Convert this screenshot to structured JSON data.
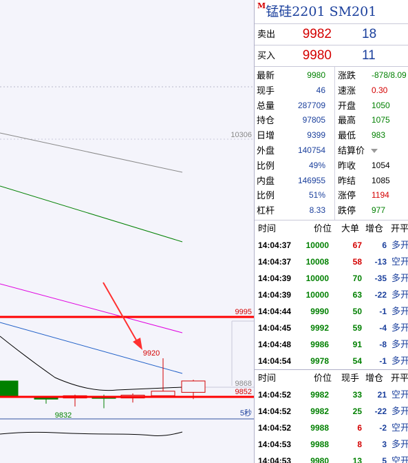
{
  "chart": {
    "level_labels": {
      "high": "10306",
      "resist": "9995",
      "current": "9868",
      "support": "9852"
    },
    "annot_high": "9920",
    "annot_low": "9832",
    "period": "5秒",
    "colors": {
      "red_line": "#ff0000",
      "bg": "#f4f4fb"
    },
    "bars": [
      {
        "type": "down",
        "open": 9880,
        "close": 9852,
        "high": 9880,
        "low": 9852
      },
      {
        "type": "down",
        "open": 9852,
        "close": 9848,
        "high": 9853,
        "low": 9840
      },
      {
        "type": "up",
        "open": 9850,
        "close": 9854,
        "high": 9856,
        "low": 9835
      },
      {
        "type": "down",
        "open": 9853,
        "close": 9850,
        "high": 9856,
        "low": 9832
      },
      {
        "type": "up",
        "open": 9850,
        "close": 9855,
        "high": 9858,
        "low": 9842
      },
      {
        "type": "up",
        "open": 9854,
        "close": 9862,
        "high": 9920,
        "low": 9852
      },
      {
        "type": "up",
        "open": 9860,
        "close": 9880,
        "high": 9882,
        "low": 9848
      }
    ]
  },
  "panel": {
    "title_mark": "M",
    "title": "锰硅2201  SM201",
    "sell": {
      "label": "卖出",
      "price": "9982",
      "vol": "18"
    },
    "buy": {
      "label": "买入",
      "price": "9980",
      "vol": "11"
    },
    "stats": [
      {
        "l1": "最新",
        "v1": "9980",
        "c1": "green",
        "l2": "涨跌",
        "v2": "-878/8.09",
        "c2": "green"
      },
      {
        "l1": "现手",
        "v1": "46",
        "c1": "blue",
        "l2": "速涨",
        "v2": "0.30",
        "c2": "red"
      },
      {
        "l1": "总量",
        "v1": "287709",
        "c1": "blue",
        "l2": "开盘",
        "v2": "1050",
        "c2": "green"
      },
      {
        "l1": "持仓",
        "v1": "97805",
        "c1": "blue",
        "l2": "最高",
        "v2": "1075",
        "c2": "green"
      },
      {
        "l1": "日增",
        "v1": "9399",
        "c1": "blue",
        "l2": "最低",
        "v2": "983",
        "c2": "green"
      },
      {
        "l1": "外盘",
        "v1": "140754",
        "c1": "blue",
        "l2": "结算价",
        "v2": "",
        "c2": "black"
      },
      {
        "l1": "比例",
        "v1": "49%",
        "c1": "blue",
        "l2": "昨收",
        "v2": "1054",
        "c2": "black"
      },
      {
        "l1": "内盘",
        "v1": "146955",
        "c1": "blue",
        "l2": "昨结",
        "v2": "1085",
        "c2": "black"
      },
      {
        "l1": "比例",
        "v1": "51%",
        "c1": "blue",
        "l2": "涨停",
        "v2": "1194",
        "c2": "red"
      },
      {
        "l1": "杠杆",
        "v1": "8.33",
        "c1": "blue",
        "l2": "跌停",
        "v2": "977",
        "c2": "green"
      }
    ],
    "ticks1_headers": [
      "时间",
      "价位",
      "大单",
      "增仓",
      "开平"
    ],
    "ticks1": [
      {
        "time": "14:04:37",
        "price": "10000",
        "vol": "67",
        "oi": "6",
        "type": "多开",
        "vc": "red",
        "pc": "green"
      },
      {
        "time": "14:04:37",
        "price": "10008",
        "vol": "58",
        "oi": "-13",
        "type": "空开",
        "vc": "red",
        "pc": "green"
      },
      {
        "time": "14:04:39",
        "price": "10000",
        "vol": "70",
        "oi": "-35",
        "type": "多开",
        "vc": "green",
        "pc": "green"
      },
      {
        "time": "14:04:39",
        "price": "10000",
        "vol": "63",
        "oi": "-22",
        "type": "多开",
        "vc": "green",
        "pc": "green"
      },
      {
        "time": "14:04:44",
        "price": "9990",
        "vol": "50",
        "oi": "-1",
        "type": "多开",
        "vc": "green",
        "pc": "green"
      },
      {
        "time": "14:04:45",
        "price": "9992",
        "vol": "59",
        "oi": "-4",
        "type": "多开",
        "vc": "green",
        "pc": "green"
      },
      {
        "time": "14:04:48",
        "price": "9986",
        "vol": "91",
        "oi": "-8",
        "type": "多开",
        "vc": "green",
        "pc": "green"
      },
      {
        "time": "14:04:54",
        "price": "9978",
        "vol": "54",
        "oi": "-1",
        "type": "多开",
        "vc": "green",
        "pc": "green"
      }
    ],
    "ticks2_headers": [
      "时间",
      "价位",
      "现手",
      "增仓",
      "开平"
    ],
    "ticks2": [
      {
        "time": "14:04:52",
        "price": "9982",
        "vol": "33",
        "oi": "21",
        "type": "空开",
        "vc": "green",
        "pc": "green"
      },
      {
        "time": "14:04:52",
        "price": "9982",
        "vol": "25",
        "oi": "-22",
        "type": "多开",
        "vc": "green",
        "pc": "green"
      },
      {
        "time": "14:04:52",
        "price": "9988",
        "vol": "6",
        "oi": "-2",
        "type": "空开",
        "vc": "red",
        "pc": "green"
      },
      {
        "time": "14:04:53",
        "price": "9988",
        "vol": "8",
        "oi": "3",
        "type": "多开",
        "vc": "red",
        "pc": "green"
      },
      {
        "time": "14:04:53",
        "price": "9980",
        "vol": "13",
        "oi": "5",
        "type": "空开",
        "vc": "green",
        "pc": "green"
      }
    ]
  }
}
